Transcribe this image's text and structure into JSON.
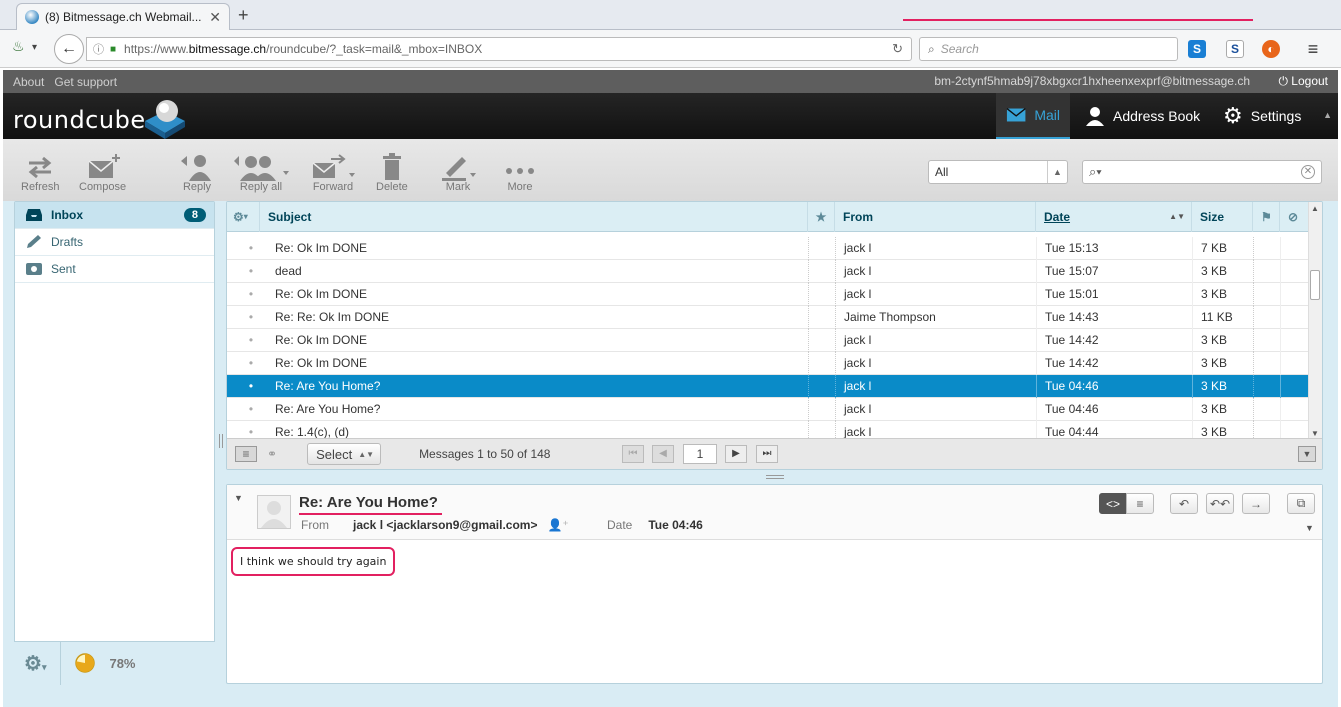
{
  "browser": {
    "tab_title": "(8) Bitmessage.ch Webmail...",
    "url_prefix": "https://www.",
    "url_domain": "bitmessage.ch",
    "url_path": "/roundcube/?_task=mail&_mbox=INBOX",
    "search_placeholder": "Search"
  },
  "topline": {
    "about": "About",
    "support": "Get support",
    "username": "bm-2ctynf5hmab9j78xbgxcr1hxheenxexprf@bitmessage.ch",
    "logout": "Logout"
  },
  "header": {
    "logo_text": "roundcube",
    "nav": [
      {
        "label": "Mail",
        "icon": "envelope-icon"
      },
      {
        "label": "Address Book",
        "icon": "person-icon"
      },
      {
        "label": "Settings",
        "icon": "gear-icon"
      }
    ]
  },
  "toolbar": {
    "refresh": "Refresh",
    "compose": "Compose",
    "reply": "Reply",
    "reply_all": "Reply all",
    "forward": "Forward",
    "delete": "Delete",
    "mark": "Mark",
    "more": "More",
    "filter_value": "All"
  },
  "folders": [
    {
      "label": "Inbox",
      "count": "8"
    },
    {
      "label": "Drafts",
      "count": ""
    },
    {
      "label": "Sent",
      "count": ""
    }
  ],
  "quota": {
    "percent": "78%",
    "fraction": 0.78
  },
  "list": {
    "headers": {
      "subject": "Subject",
      "from": "From",
      "date": "Date",
      "size": "Size"
    },
    "rows": [
      {
        "subject": "Re: Ok Im DONE",
        "from": "jack l",
        "date": "Tue 15:13",
        "size": "7 KB",
        "selected": false
      },
      {
        "subject": "dead",
        "from": "jack l",
        "date": "Tue 15:07",
        "size": "3 KB",
        "selected": false
      },
      {
        "subject": "Re: Ok Im DONE",
        "from": "jack l",
        "date": "Tue 15:01",
        "size": "3 KB",
        "selected": false
      },
      {
        "subject": "Re: Re: Ok Im DONE",
        "from": "Jaime Thompson",
        "date": "Tue 14:43",
        "size": "11 KB",
        "selected": false
      },
      {
        "subject": "Re: Ok Im DONE",
        "from": "jack l",
        "date": "Tue 14:42",
        "size": "3 KB",
        "selected": false
      },
      {
        "subject": "Re: Ok Im DONE",
        "from": "jack l",
        "date": "Tue 14:42",
        "size": "3 KB",
        "selected": false
      },
      {
        "subject": "Re: Are You Home?",
        "from": "jack l",
        "date": "Tue 04:46",
        "size": "3 KB",
        "selected": true
      },
      {
        "subject": "Re: Are You Home?",
        "from": "jack l",
        "date": "Tue 04:46",
        "size": "3 KB",
        "selected": false
      },
      {
        "subject": "Re: 1.4(c), (d)",
        "from": "jack l",
        "date": "Tue 04:44",
        "size": "3 KB",
        "selected": false
      }
    ],
    "footer": {
      "select_label": "Select",
      "count_text": "Messages 1 to 50 of 148",
      "page": "1"
    }
  },
  "message": {
    "subject": "Re: Are You Home?",
    "from_label": "From",
    "from_value": "jack l <jacklarson9@gmail.com>",
    "date_label": "Date",
    "date_value": "Tue 04:46",
    "body": "I think we should try again"
  }
}
